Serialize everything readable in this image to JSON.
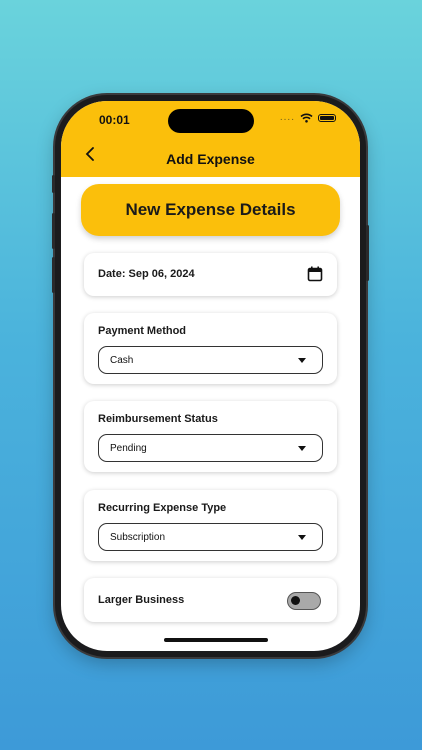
{
  "status_bar": {
    "time": "00:01",
    "signal_dots": "....",
    "icons": [
      "wifi-icon",
      "battery-icon"
    ]
  },
  "header": {
    "title": "Add Expense",
    "back_icon": "chevron-left-icon"
  },
  "banner": {
    "text": "New Expense Details"
  },
  "date_card": {
    "label": "Date: Sep 06, 2024",
    "icon": "calendar-icon"
  },
  "payment": {
    "label": "Payment Method",
    "value": "Cash"
  },
  "reimbursement": {
    "label": "Reimbursement Status",
    "value": "Pending"
  },
  "recurring": {
    "label": "Recurring Expense Type",
    "value": "Subscription"
  },
  "business": {
    "label": "Larger Business",
    "toggle_on": false
  },
  "colors": {
    "accent": "#fbbf0b",
    "bg_top": "#6ad3dc",
    "bg_bottom": "#3d9ad8"
  }
}
